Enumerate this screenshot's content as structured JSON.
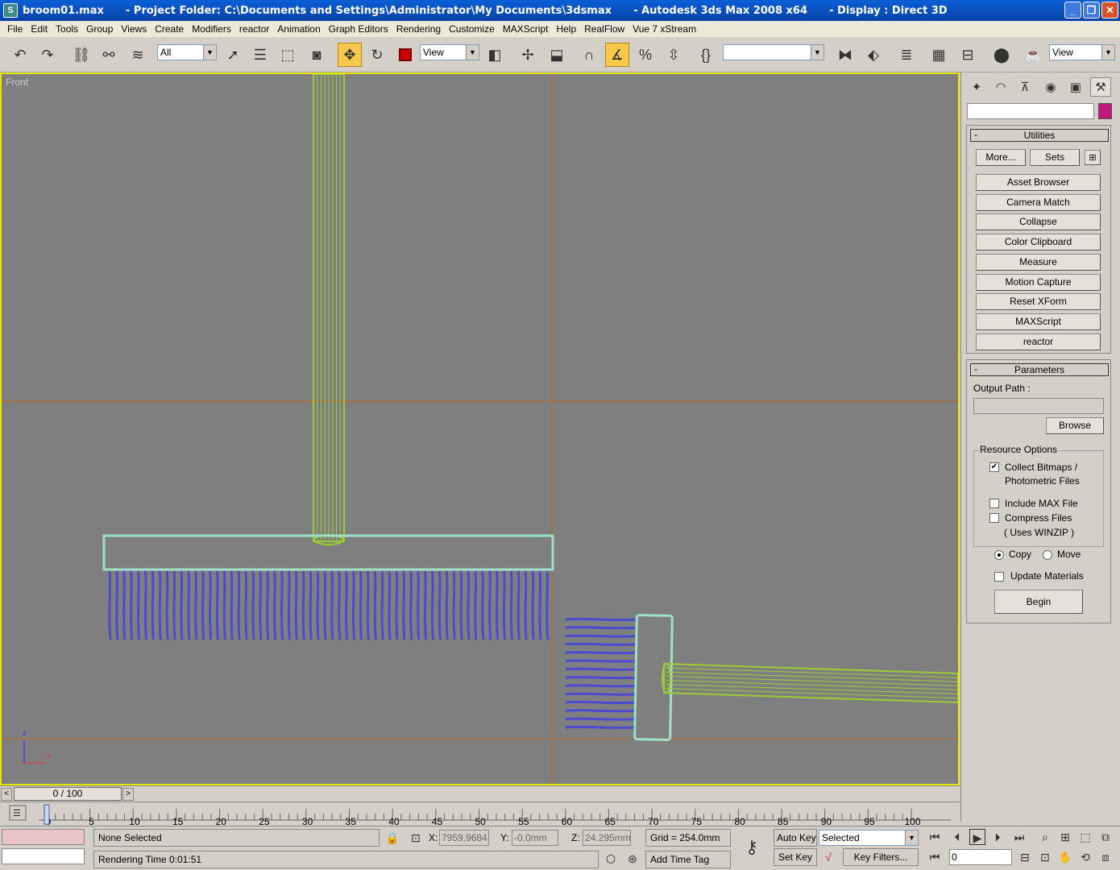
{
  "window": {
    "title": "broom01.max      - Project Folder: C:\\Documents and Settings\\Administrator\\My Documents\\3dsmax      - Autodesk 3ds Max 2008 x64      - Display : Direct 3D",
    "icon_name": "3dsmax-app-icon",
    "controls": [
      "minimize-icon",
      "restore-icon",
      "close-icon"
    ]
  },
  "menu": {
    "items": [
      "File",
      "Edit",
      "Tools",
      "Group",
      "Views",
      "Create",
      "Modifiers",
      "reactor",
      "Animation",
      "Graph Editors",
      "Rendering",
      "Customize",
      "MAXScript",
      "Help",
      "RealFlow",
      "Vue 7 xStream"
    ]
  },
  "toolbar": {
    "selection_filter": "All",
    "ref_coord_system": "View",
    "named_selection": "",
    "render_view": "View",
    "active_tool": "select-and-move",
    "angle_snap_active": true
  },
  "viewport": {
    "label": "Front",
    "axis_labels": {
      "z": "z",
      "x": "x"
    },
    "border_color": "#e6e600",
    "background_color": "#7f7f7f",
    "handle_color": "#9acd32",
    "bristle_color": "#4b4bcf",
    "head_color": "#a0e0c8"
  },
  "command_panel": {
    "active_tab": "utilities",
    "object_color": "#c0187a",
    "utilities": {
      "title": "Utilities",
      "more_label": "More...",
      "sets_label": "Sets",
      "buttons": [
        "Asset Browser",
        "Camera Match",
        "Collapse",
        "Color Clipboard",
        "Measure",
        "Motion Capture",
        "Reset XForm",
        "MAXScript",
        "reactor"
      ]
    },
    "parameters": {
      "title": "Parameters",
      "output_path_label": "Output Path :",
      "output_path_value": "",
      "browse_label": "Browse",
      "resource_options_label": "Resource Options",
      "collect_bitmaps_line1": "Collect Bitmaps /",
      "collect_bitmaps_line2": "Photometric Files",
      "collect_bitmaps_checked": true,
      "include_max_label": "Include MAX File",
      "include_max_checked": false,
      "compress_label": "Compress Files",
      "compress_checked": false,
      "uses_winzip_label": "( Uses WINZIP )",
      "copy_label": "Copy",
      "move_label": "Move",
      "copy_selected": true,
      "update_materials_label": "Update Materials",
      "update_materials_checked": false,
      "begin_label": "Begin"
    }
  },
  "timeline": {
    "frame_display": "0 / 100",
    "current_frame": 0,
    "total_frames": 100,
    "tick_labels": [
      "0",
      "5",
      "10",
      "15",
      "20",
      "25",
      "30",
      "35",
      "40",
      "45",
      "50",
      "55",
      "60",
      "65",
      "70",
      "75",
      "80",
      "85",
      "90",
      "95",
      "100"
    ]
  },
  "status": {
    "selection_text": "None Selected",
    "prompt_text": "Rendering Time  0:01:51",
    "x_label": "X:",
    "x_value": "7959.9684",
    "y_label": "Y:",
    "y_value": "-0.0mm",
    "z_label": "Z:",
    "z_value": "24.295mm",
    "grid_text": "Grid = 254.0mm",
    "add_time_tag": "Add Time Tag",
    "auto_key_label": "Auto Key",
    "set_key_label": "Set Key",
    "key_mode_value": "Selected",
    "key_filters_label": "Key Filters...",
    "frame_input": "0"
  }
}
